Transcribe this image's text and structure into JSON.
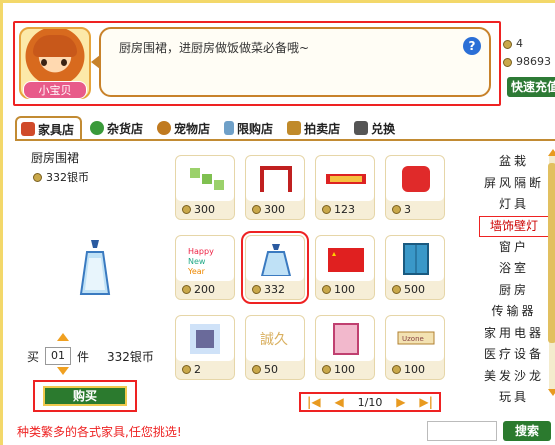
{
  "header": {
    "avatar_name": "小宝贝",
    "bubble_text": "厨房围裙，进厨房做饭做菜必备哦~",
    "help_label": "?"
  },
  "stats": {
    "count_a": "4",
    "count_b": "98693",
    "quick_label": "快速充值"
  },
  "tabs": [
    {
      "label": "家具店",
      "icon": "home-icon",
      "color": "#d04a2a"
    },
    {
      "label": "杂货店",
      "icon": "clover-icon",
      "color": "#3a9a3a"
    },
    {
      "label": "宠物店",
      "icon": "dog-icon",
      "color": "#c07a20"
    },
    {
      "label": "限购店",
      "icon": "bottle-icon",
      "color": "#6fa0c8"
    },
    {
      "label": "拍卖店",
      "icon": "hammer-icon",
      "color": "#c08a2a"
    },
    {
      "label": "兑换",
      "icon": "shop-icon",
      "color": "#555"
    }
  ],
  "selected_item": {
    "name": "厨房围裙",
    "price": "332银币"
  },
  "purchase": {
    "qty_prefix": "买",
    "qty_value": "01",
    "qty_unit": "件",
    "total": "332银币",
    "buy_label": "购买"
  },
  "items": [
    {
      "price": "300",
      "art": "green-tiles"
    },
    {
      "price": "300",
      "art": "red-frame"
    },
    {
      "price": "123",
      "art": "red-banner"
    },
    {
      "price": "3",
      "art": "red-sign"
    },
    {
      "price": "200",
      "art": "color-letters"
    },
    {
      "price": "332",
      "art": "apron"
    },
    {
      "price": "100",
      "art": "china-flag"
    },
    {
      "price": "500",
      "art": "blue-window"
    },
    {
      "price": "2",
      "art": "book-picture"
    },
    {
      "price": "50",
      "art": "gold-word"
    },
    {
      "price": "100",
      "art": "pink-frame"
    },
    {
      "price": "100",
      "art": "sign-board"
    }
  ],
  "categories": [
    {
      "label": "盆栽",
      "active": false
    },
    {
      "label": "屏风隔断",
      "active": false
    },
    {
      "label": "灯具",
      "active": false
    },
    {
      "label": "墙饰壁灯",
      "active": true
    },
    {
      "label": "窗户",
      "active": false
    },
    {
      "label": "浴室",
      "active": false
    },
    {
      "label": "厨房",
      "active": false
    },
    {
      "label": "传输器",
      "active": false
    },
    {
      "label": "家用电器",
      "active": false
    },
    {
      "label": "医疗设备",
      "active": false
    },
    {
      "label": "美发沙龙",
      "active": false
    },
    {
      "label": "玩具",
      "active": false
    }
  ],
  "pager": {
    "text": "1/10"
  },
  "footer": {
    "message": "种类繁多的各式家具,任您挑选!",
    "search_label": "搜索"
  },
  "colors": {
    "accent": "#e22",
    "gold": "#c28b33",
    "green": "#2b7a2e"
  }
}
